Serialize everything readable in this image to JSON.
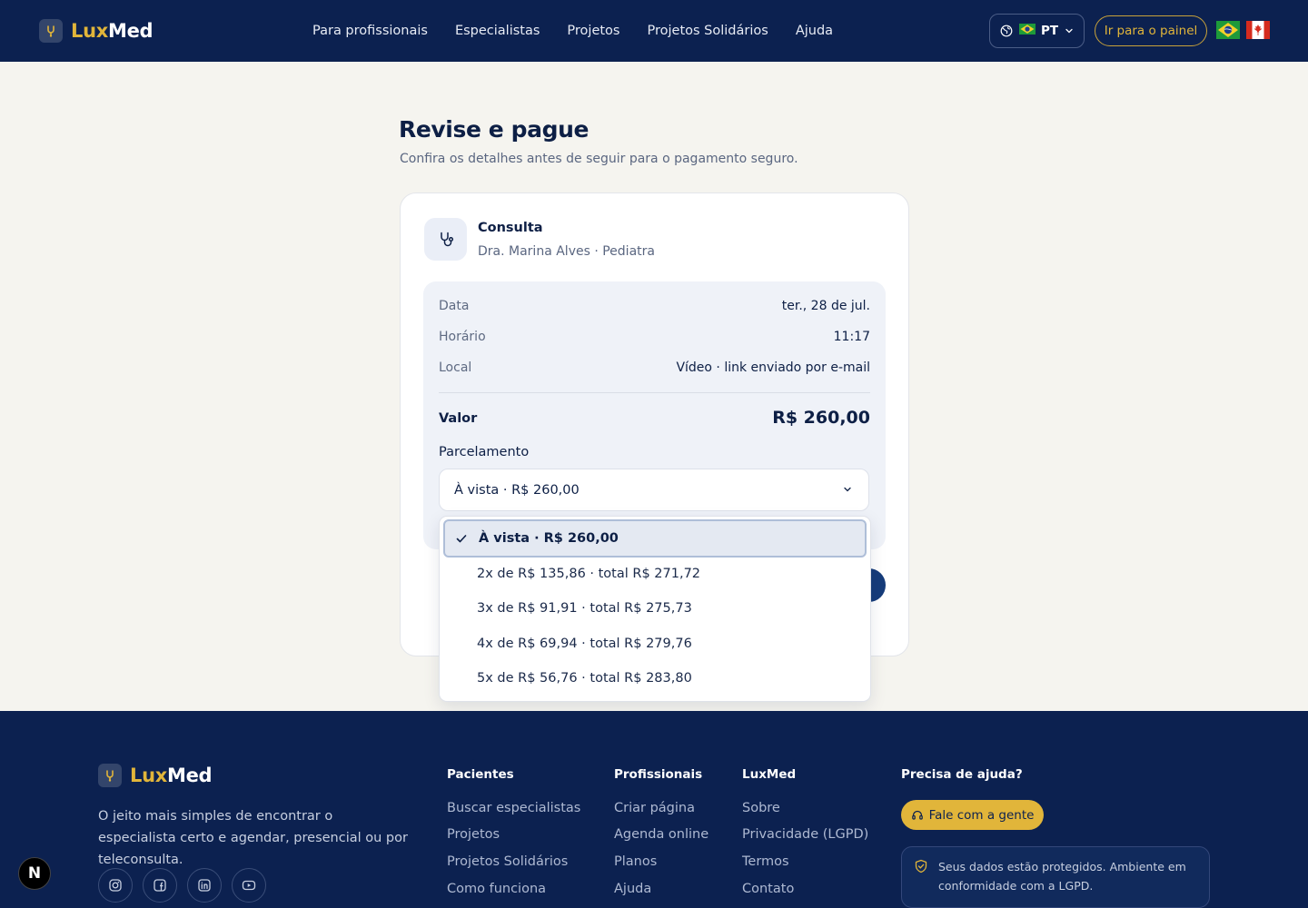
{
  "header": {
    "logo_lux": "Lux",
    "logo_med": "Med",
    "nav": [
      "Para profissionais",
      "Especialistas",
      "Projetos",
      "Projetos Solidários",
      "Ajuda"
    ],
    "lang_code": "PT",
    "panel_button": "Ir para o painel"
  },
  "main": {
    "title": "Revise e pague",
    "subtitle": "Confira os detalhes antes de seguir para o pagamento seguro.",
    "service_title": "Consulta",
    "service_sub": "Dra. Marina Alves · Pediatra",
    "rows": [
      {
        "label": "Data",
        "value": "ter., 28 de jul."
      },
      {
        "label": "Horário",
        "value": "11:17"
      },
      {
        "label": "Local",
        "value": "Vídeo · link enviado por e-mail"
      }
    ],
    "valor_label": "Valor",
    "valor_value": "R$ 260,00",
    "parcelamento_label": "Parcelamento",
    "parcelamento_selected": "À vista · R$ 260,00",
    "options": [
      "À vista · R$ 260,00",
      "2x de R$ 135,86 · total R$ 271,72",
      "3x de R$ 91,91 · total R$ 275,73",
      "4x de R$ 69,94 · total R$ 279,76",
      "5x de R$ 56,76 · total R$ 283,80"
    ]
  },
  "footer": {
    "logo_lux": "Lux",
    "logo_med": "Med",
    "description": "O jeito mais simples de encontrar o especialista certo e agendar, presencial ou por teleconsulta.",
    "columns": [
      {
        "title": "Pacientes",
        "links": [
          "Buscar especialistas",
          "Projetos",
          "Projetos Solidários",
          "Como funciona"
        ]
      },
      {
        "title": "Profissionais",
        "links": [
          "Criar página",
          "Agenda online",
          "Planos",
          "Ajuda"
        ]
      },
      {
        "title": "LuxMed",
        "links": [
          "Sobre",
          "Privacidade (LGPD)",
          "Termos",
          "Contato"
        ]
      }
    ],
    "help_title": "Precisa de ajuda?",
    "help_button": "Fale com a gente",
    "lgpd_text": "Seus dados estão protegidos. Ambiente em conformidade com a LGPD."
  },
  "badge": "N",
  "colors": {
    "navy": "#0c2150",
    "gold": "#e1b53a",
    "background": "#f5f4ef"
  }
}
